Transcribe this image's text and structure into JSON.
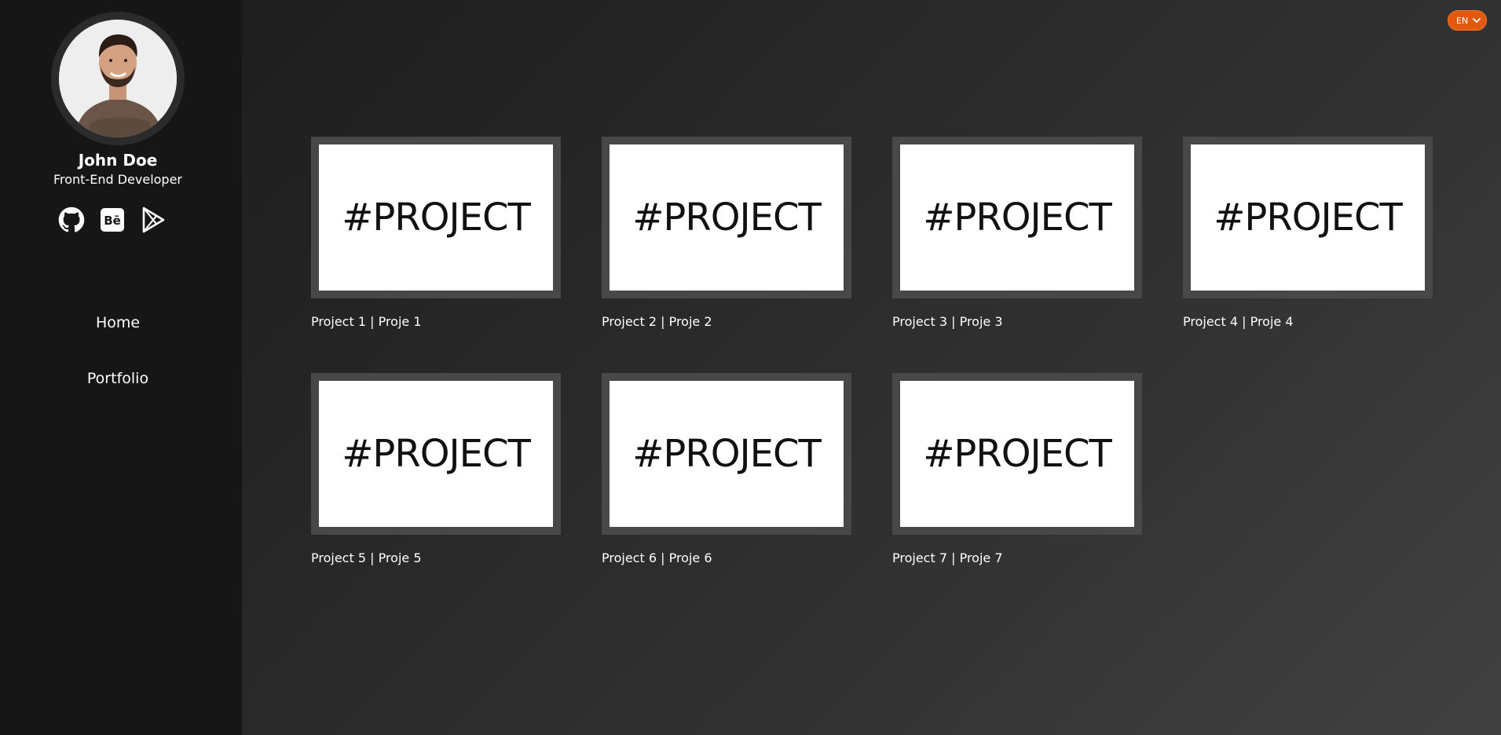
{
  "profile": {
    "name": "John Doe",
    "title": "Front-End Developer"
  },
  "socials": [
    {
      "icon": "github-icon"
    },
    {
      "icon": "behance-icon",
      "glyph": "Bē"
    },
    {
      "icon": "google-play-icon"
    }
  ],
  "nav": {
    "home": "Home",
    "portfolio": "Portfolio"
  },
  "language": {
    "selected": "EN"
  },
  "projects": [
    {
      "thumb_text": "#PROJECT",
      "label": "Project 1 | Proje 1"
    },
    {
      "thumb_text": "#PROJECT",
      "label": "Project 2 | Proje 2"
    },
    {
      "thumb_text": "#PROJECT",
      "label": "Project 3 | Proje 3"
    },
    {
      "thumb_text": "#PROJECT",
      "label": "Project 4 | Proje 4"
    },
    {
      "thumb_text": "#PROJECT",
      "label": "Project 5 | Proje 5"
    },
    {
      "thumb_text": "#PROJECT",
      "label": "Project 6 | Proje 6"
    },
    {
      "thumb_text": "#PROJECT",
      "label": "Project 7 | Proje 7"
    }
  ],
  "colors": {
    "sidebar": "#161616",
    "accent": "#e2580c",
    "thumb_frame": "#484848"
  }
}
